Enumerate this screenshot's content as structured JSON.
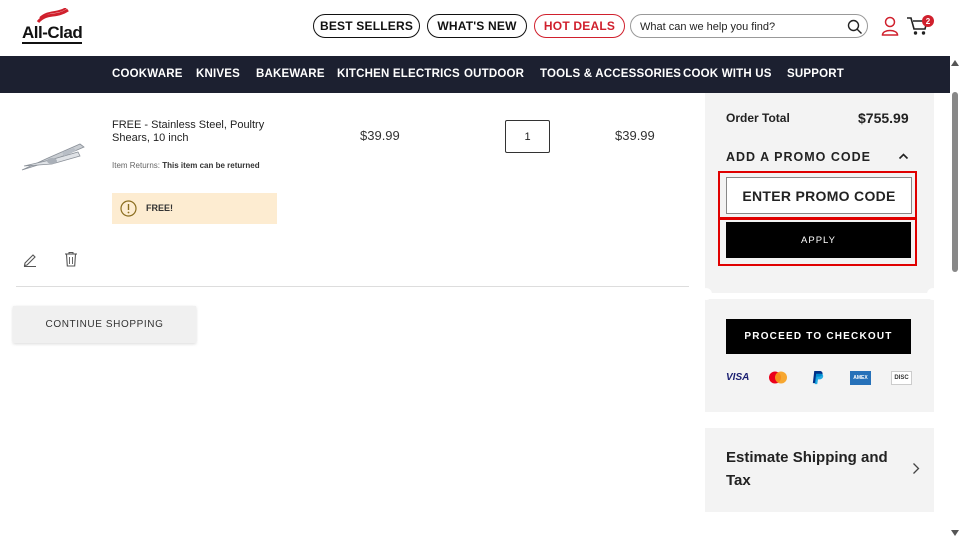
{
  "header": {
    "logo_text": "All-Clad",
    "best_sellers": "BEST SELLERS",
    "whats_new": "WHAT'S NEW",
    "hot_deals": "HOT DEALS",
    "search_placeholder": "What can we help you find?",
    "cart_count": "2"
  },
  "nav": {
    "items": [
      "COOKWARE",
      "KNIVES",
      "BAKEWARE",
      "KITCHEN ELECTRICS",
      "OUTDOOR",
      "TOOLS & ACCESSORIES",
      "COOK WITH US",
      "SUPPORT"
    ]
  },
  "cart_item": {
    "name": "FREE - Stainless Steel, Poultry Shears, 10 inch",
    "returns_label": "Item Returns:",
    "returns_value": "This item can be returned",
    "free_label": "FREE!",
    "unit_price": "$39.99",
    "quantity": "1",
    "total_price": "$39.99"
  },
  "continue_shopping": "CONTINUE SHOPPING",
  "summary": {
    "order_total_label": "Order Total",
    "order_total_value": "$755.99",
    "promo_heading": "ADD A PROMO CODE",
    "promo_placeholder": "ENTER PROMO CODE",
    "apply_label": "APPLY",
    "checkout_label": "PROCEED TO CHECKOUT",
    "payment_methods": [
      "VISA",
      "Mastercard",
      "PayPal",
      "AMEX",
      "DISC"
    ],
    "shipping_label": "Estimate Shipping and Tax"
  },
  "colors": {
    "nav_bg": "#1c2030",
    "hot_red": "#d0202d",
    "highlight": "#e00000",
    "panel_bg": "#f3f3f3",
    "free_bg": "#fdecd1"
  }
}
